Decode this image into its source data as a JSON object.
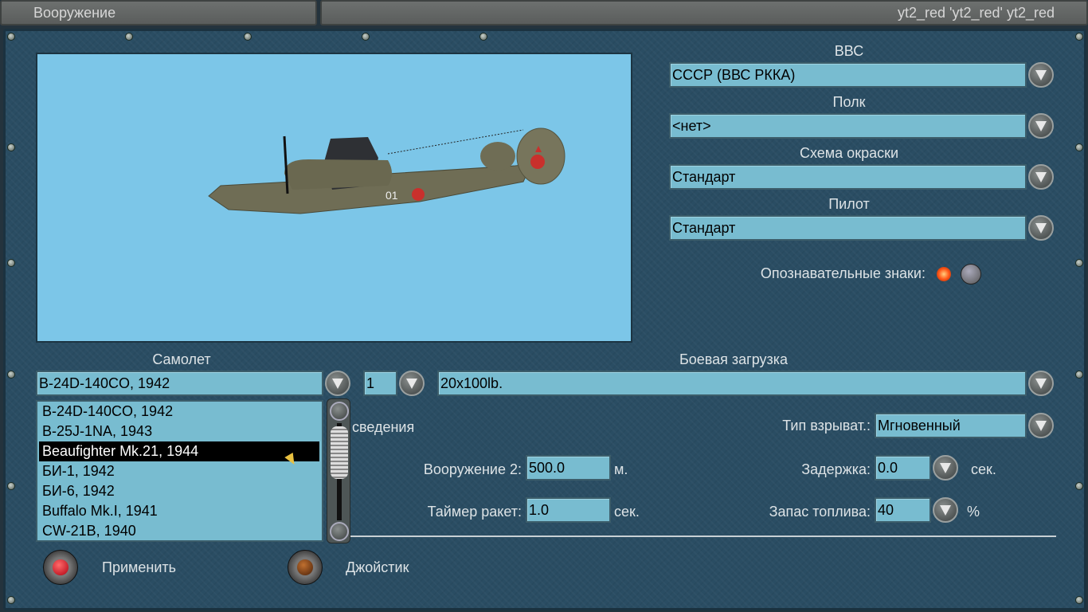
{
  "window": {
    "title": "Вооружение",
    "player": "yt2_red 'yt2_red' yt2_red"
  },
  "right": {
    "air_force": {
      "label": "ВВС",
      "value": "СССР (ВВС РККА)"
    },
    "regiment": {
      "label": "Полк",
      "value": "<нет>"
    },
    "skin": {
      "label": "Схема окраски",
      "value": "Стандарт"
    },
    "pilot": {
      "label": "Пилот",
      "value": "Стандарт"
    },
    "markings": {
      "label": "Опознавательные знаки:",
      "on": true
    }
  },
  "aircraft": {
    "label": "Самолет",
    "value": "B-24D-140CO, 1942",
    "count": "1",
    "list": [
      "B-24D-140CO, 1942",
      "B-25J-1NA, 1943",
      "Beaufighter Mk.21, 1944",
      "БИ-1, 1942",
      "БИ-6, 1942",
      "Buffalo Mk.I, 1941",
      "CW-21B, 1940"
    ],
    "selected_index": 2
  },
  "loadout": {
    "label": "Боевая загрузка",
    "value": "20x100lb."
  },
  "settings": {
    "partial_label": "сведения",
    "convergence": {
      "label": "Вооружение 2:",
      "value": "500.0",
      "unit": "м."
    },
    "rocket_timer": {
      "label": "Таймер ракет:",
      "value": "1.0",
      "unit": "сек."
    },
    "fuze_type": {
      "label": "Тип взрыват.:",
      "value": "Мгновенный"
    },
    "delay": {
      "label": "Задержка:",
      "value": "0.0",
      "unit": "сек."
    },
    "fuel": {
      "label": "Запас топлива:",
      "value": "40",
      "unit": "%"
    }
  },
  "buttons": {
    "apply": "Применить",
    "joystick": "Джойстик"
  },
  "plane_marking": "01"
}
